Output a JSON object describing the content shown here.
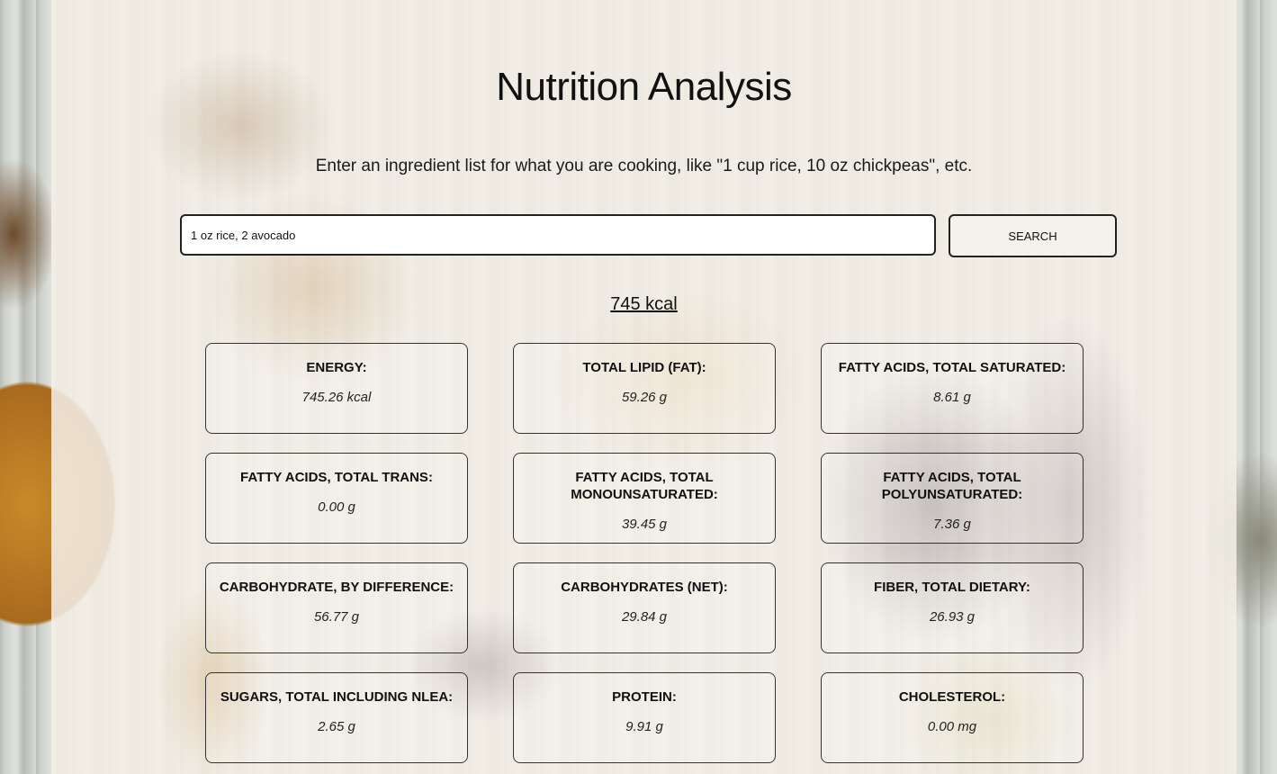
{
  "page": {
    "title": "Nutrition Analysis",
    "subtitle": "Enter an ingredient list for what you are cooking, like \"1 cup rice, 10 oz chickpeas\", etc."
  },
  "search": {
    "value": "1 oz rice, 2 avocado",
    "button_label": "SEARCH"
  },
  "total_calories": "745 kcal",
  "nutrients": [
    {
      "label": "ENERGY:",
      "value": "745.26 kcal"
    },
    {
      "label": "TOTAL LIPID (FAT):",
      "value": "59.26 g"
    },
    {
      "label": "FATTY ACIDS, TOTAL SATURATED:",
      "value": "8.61 g"
    },
    {
      "label": "FATTY ACIDS, TOTAL TRANS:",
      "value": "0.00 g"
    },
    {
      "label": "FATTY ACIDS, TOTAL MONOUNSATURATED:",
      "value": "39.45 g"
    },
    {
      "label": "FATTY ACIDS, TOTAL POLYUNSATURATED:",
      "value": "7.36 g"
    },
    {
      "label": "CARBOHYDRATE, BY DIFFERENCE:",
      "value": "56.77 g"
    },
    {
      "label": "CARBOHYDRATES (NET):",
      "value": "29.84 g"
    },
    {
      "label": "FIBER, TOTAL DIETARY:",
      "value": "26.93 g"
    },
    {
      "label": "SUGARS, TOTAL INCLUDING NLEA:",
      "value": "2.65 g"
    },
    {
      "label": "PROTEIN:",
      "value": "9.91 g"
    },
    {
      "label": "CHOLESTEROL:",
      "value": "0.00 mg"
    }
  ]
}
